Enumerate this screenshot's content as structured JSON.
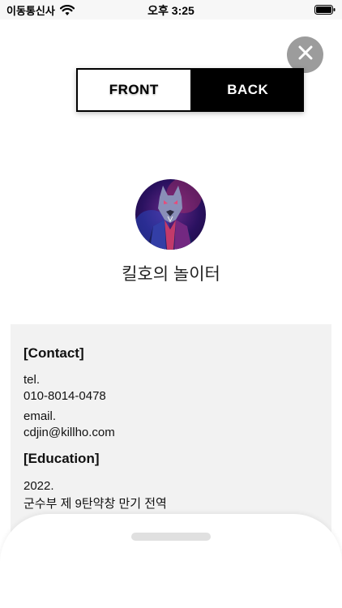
{
  "status_bar": {
    "carrier": "이동통신사",
    "time": "오후 3:25"
  },
  "toggle": {
    "front_label": "FRONT",
    "back_label": "BACK",
    "selected": "BACK"
  },
  "profile": {
    "name": "킬호의 놀이터"
  },
  "contact": {
    "heading": "[Contact]",
    "tel_label": "tel.",
    "tel_value": "010-8014-0478",
    "email_label": "email.",
    "email_value": "cdjin@killho.com"
  },
  "education": {
    "heading": "[Education]",
    "year": "2022.",
    "detail": "군수부 제 9탄약창 만기 전역"
  },
  "colors": {
    "close_button": "#9c9c9c",
    "panel": "#f2f2f2",
    "toggle_selected": "#000000"
  }
}
